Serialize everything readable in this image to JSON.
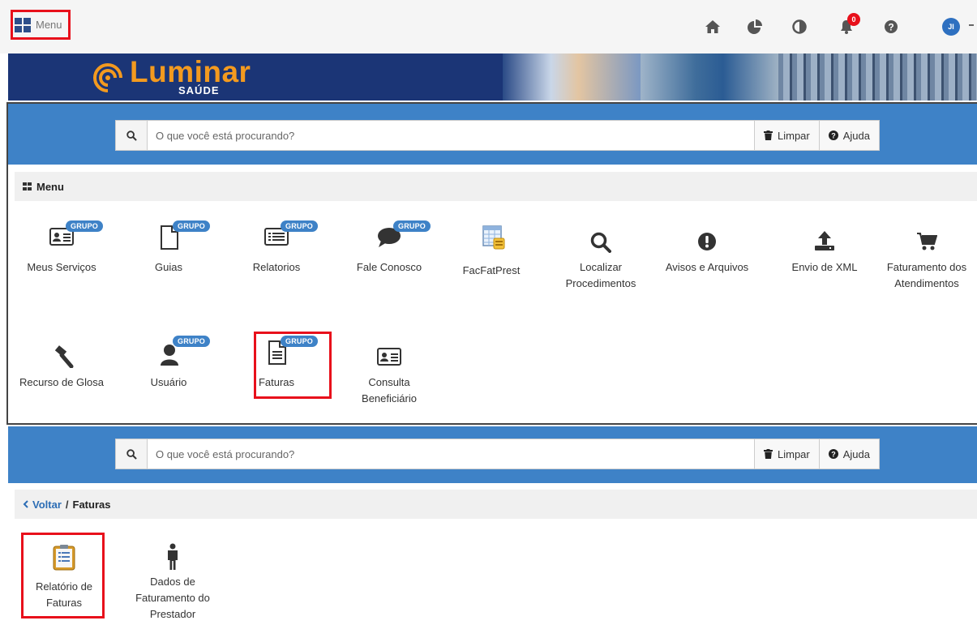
{
  "topbar": {
    "menu_label": "Menu",
    "notification_count": "0",
    "user_initials": "JI",
    "icons": [
      "home-icon",
      "pie-chart-icon",
      "contrast-icon",
      "bell-icon",
      "help-icon"
    ]
  },
  "brand": {
    "name": "Luminar",
    "sub": "SAÚDE"
  },
  "search": {
    "placeholder": "O que você está procurando?",
    "clear_label": "Limpar",
    "help_label": "Ajuda"
  },
  "menu_section": {
    "title": "Menu",
    "badge": "GRUPO",
    "items": [
      {
        "label": "Meus Serviços",
        "icon": "id-card-icon",
        "grupo": true
      },
      {
        "label": "Guias",
        "icon": "document-icon",
        "grupo": true
      },
      {
        "label": "Relatorios",
        "icon": "list-icon",
        "grupo": true
      },
      {
        "label": "Fale Conosco",
        "icon": "chat-icon",
        "grupo": true
      },
      {
        "label": "FacFatPrest",
        "icon": "spreadsheet-icon",
        "grupo": false
      },
      {
        "label": "Localizar Procedimentos",
        "icon": "search-icon",
        "grupo": false
      },
      {
        "label": "Avisos e Arquivos",
        "icon": "exclamation-icon",
        "grupo": false
      },
      {
        "label": "Envio de XML",
        "icon": "upload-icon",
        "grupo": false
      },
      {
        "label": "Faturamento dos Atendimentos",
        "icon": "cart-icon",
        "grupo": false
      },
      {
        "label": "Recurso de Glosa",
        "icon": "gavel-icon",
        "grupo": false
      },
      {
        "label": "Usuário",
        "icon": "user-icon",
        "grupo": true
      },
      {
        "label": "Faturas",
        "icon": "invoice-icon",
        "grupo": true
      },
      {
        "label": "Consulta Beneficiário",
        "icon": "id-card-icon",
        "grupo": false
      }
    ]
  },
  "faturas_section": {
    "back_label": "Voltar",
    "separator": "/",
    "title": "Faturas",
    "items": [
      {
        "label": "Relatório de Faturas",
        "icon": "clipboard-report-icon"
      },
      {
        "label": "Dados de Faturamento do Prestador",
        "icon": "person-icon"
      }
    ]
  },
  "colors": {
    "accent": "#3e82c7",
    "highlight": "#e8101b",
    "brand_navy": "#1b3576",
    "brand_orange": "#f39a1f"
  }
}
